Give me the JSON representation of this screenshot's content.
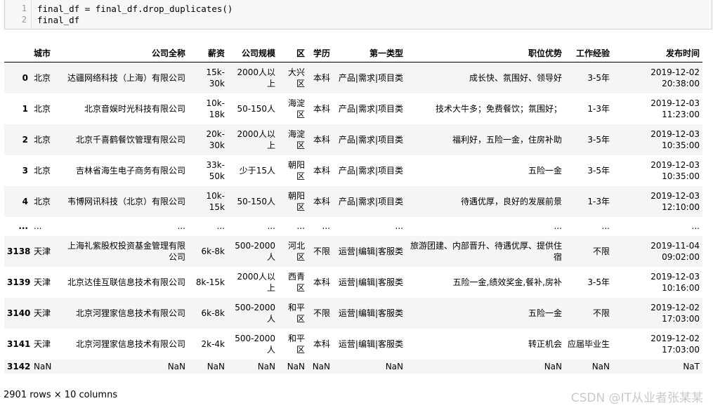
{
  "code_cell": {
    "lines": [
      {
        "number": "1",
        "code": "final_df = final_df.drop_duplicates()"
      },
      {
        "number": "2",
        "code": "final_df"
      }
    ]
  },
  "table": {
    "columns": [
      "城市",
      "公司全称",
      "薪资",
      "公司规模",
      "区",
      "学历",
      "第一类型",
      "职位优势",
      "工作经验",
      "发布时间"
    ],
    "rows": [
      {
        "index": "0",
        "cells": [
          "北京",
          "达疆网络科技（上海）有限公司",
          "15k-30k",
          "2000人以上",
          "大兴区",
          "本科",
          "产品|需求|项目类",
          "成长快、氛围好、领导好",
          "3-5年",
          "2019-12-02 20:38:00"
        ]
      },
      {
        "index": "1",
        "cells": [
          "北京",
          "北京音娱时光科技有限公司",
          "10k-18k",
          "50-150人",
          "海淀区",
          "本科",
          "产品|需求|项目类",
          "技术大牛多；免费餐饮；氛围好；",
          "1-3年",
          "2019-12-03 11:23:00"
        ]
      },
      {
        "index": "2",
        "cells": [
          "北京",
          "北京千喜鹤餐饮管理有限公司",
          "20k-30k",
          "2000人以上",
          "海淀区",
          "本科",
          "产品|需求|项目类",
          "福利好，五险一金，住房补助",
          "3-5年",
          "2019-12-03 10:35:00"
        ]
      },
      {
        "index": "3",
        "cells": [
          "北京",
          "吉林省海生电子商务有限公司",
          "33k-50k",
          "少于15人",
          "朝阳区",
          "本科",
          "产品|需求|项目类",
          "五险一金",
          "3-5年",
          "2019-12-03 10:35:00"
        ]
      },
      {
        "index": "4",
        "cells": [
          "北京",
          "韦博网讯科技（北京）有限公司",
          "10k-15k",
          "50-150人",
          "朝阳区",
          "本科",
          "产品|需求|项目类",
          "待遇优厚，良好的发展前景",
          "1-3年",
          "2019-12-03 12:10:00"
        ]
      },
      {
        "index": "...",
        "cells": [
          "...",
          "...",
          "...",
          "...",
          "...",
          "...",
          "...",
          "...",
          "...",
          "..."
        ]
      },
      {
        "index": "3138",
        "cells": [
          "天津",
          "上海礼紫股权投资基金管理有限公司",
          "6k-8k",
          "500-2000人",
          "河北区",
          "不限",
          "运营|编辑|客服类",
          "旅游团建、内部晋升、待遇优厚、提供住宿",
          "不限",
          "2019-11-04 09:02:00"
        ]
      },
      {
        "index": "3139",
        "cells": [
          "天津",
          "北京达佳互联信息技术有限公司",
          "8k-15k",
          "2000人以上",
          "西青区",
          "本科",
          "运营|编辑|客服类",
          "五险一金,绩效奖金,餐补,房补",
          "3-5年",
          "2019-12-03 10:16:00"
        ]
      },
      {
        "index": "3140",
        "cells": [
          "天津",
          "北京河狸家信息技术有限公司",
          "6k-8k",
          "500-2000人",
          "和平区",
          "不限",
          "运营|编辑|客服类",
          "五险一金",
          "不限",
          "2019-12-02 17:03:00"
        ]
      },
      {
        "index": "3141",
        "cells": [
          "天津",
          "北京河狸家信息技术有限公司",
          "2k-4k",
          "500-2000人",
          "和平区",
          "本科",
          "运营|编辑|客服类",
          "转正机会",
          "应届毕业生",
          "2019-12-02 17:03:00"
        ]
      },
      {
        "index": "3142",
        "cells": [
          "NaN",
          "NaN",
          "NaN",
          "NaN",
          "NaN",
          "NaN",
          "NaN",
          "NaN",
          "NaN",
          "NaT"
        ]
      }
    ]
  },
  "shape_text": "2901 rows × 10 columns",
  "watermark": "CSDN @IT从业者张某某"
}
